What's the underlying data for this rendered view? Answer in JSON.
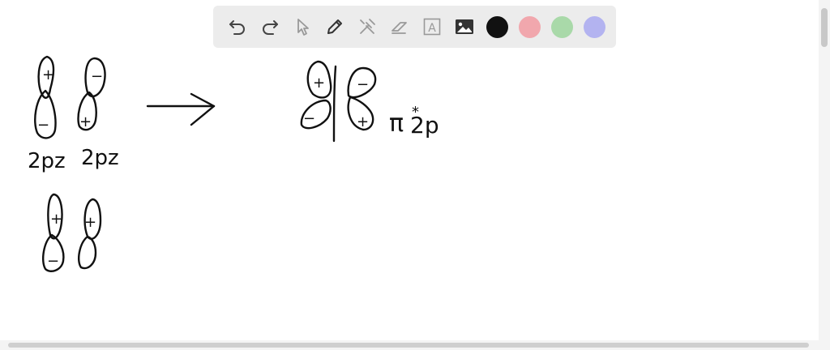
{
  "toolbar": {
    "tools": [
      {
        "name": "undo-icon"
      },
      {
        "name": "redo-icon"
      },
      {
        "name": "select-pointer-icon"
      },
      {
        "name": "pen-icon"
      },
      {
        "name": "tools-icon"
      },
      {
        "name": "eraser-icon"
      },
      {
        "name": "text-box-icon",
        "glyph": "A"
      },
      {
        "name": "image-icon"
      }
    ],
    "colors": [
      "#111111",
      "#f1a7ad",
      "#a9d9a9",
      "#b3b3f0"
    ]
  },
  "drawing": {
    "lobe_signs": {
      "plus": "+",
      "minus": "−"
    },
    "label_left_1": "2pz",
    "label_left_2": "2pz",
    "label_result_pi": "π",
    "label_result_star": "*",
    "label_result_2p": "2p"
  }
}
